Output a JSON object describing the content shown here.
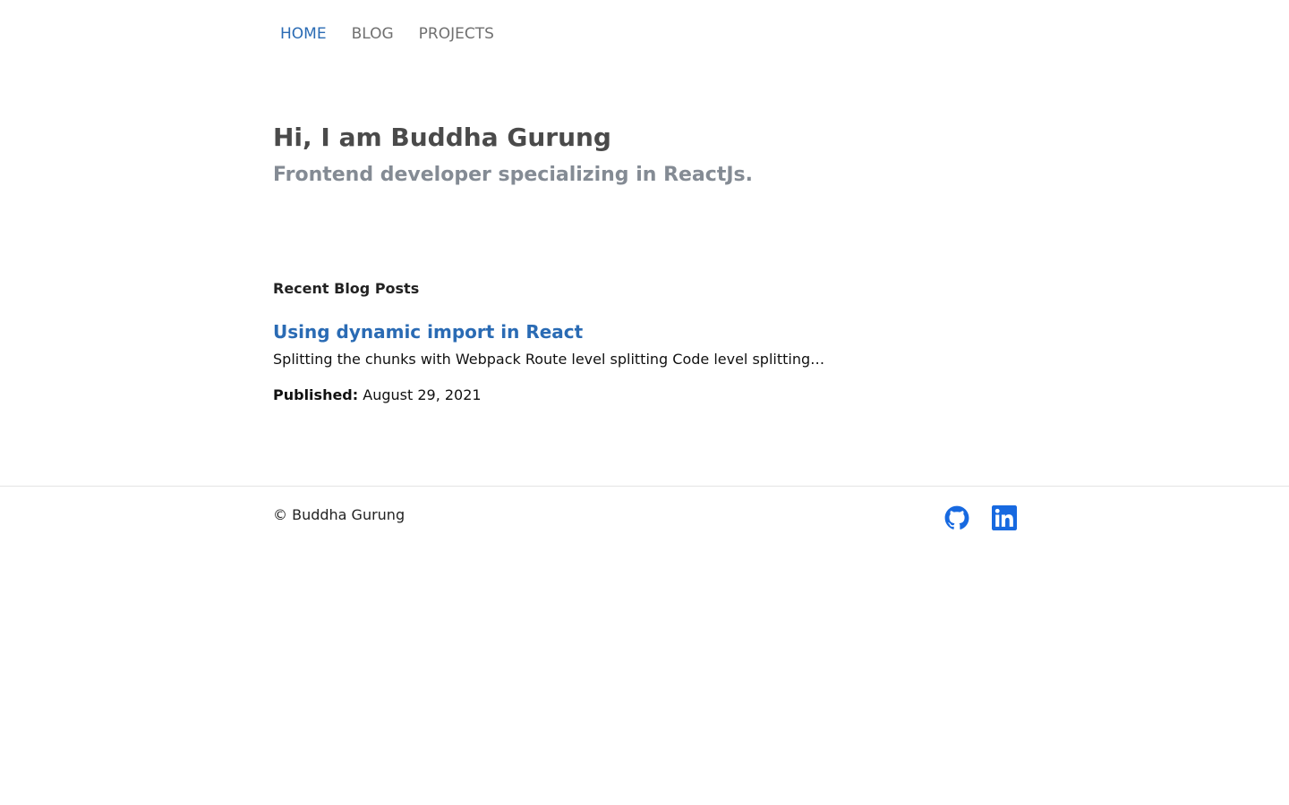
{
  "nav": {
    "items": [
      {
        "label": "HOME",
        "active": true
      },
      {
        "label": "BLOG",
        "active": false
      },
      {
        "label": "PROJECTS",
        "active": false
      }
    ]
  },
  "hero": {
    "title": "Hi, I am Buddha Gurung",
    "subtitle": "Frontend developer specializing in ReactJs."
  },
  "blog": {
    "heading": "Recent Blog Posts",
    "posts": [
      {
        "title": "Using dynamic import in React",
        "excerpt": "Splitting the chunks with Webpack Route level splitting Code level splitting…",
        "published_label": "Published:",
        "published_date": "August 29, 2021"
      }
    ]
  },
  "footer": {
    "copyright": "© Buddha Gurung",
    "social": [
      {
        "icon": "github-icon"
      },
      {
        "icon": "linkedin-icon"
      }
    ]
  },
  "colors": {
    "accent": "#2a6bb4",
    "nav_inactive": "#707070",
    "social_icon": "#1769e0"
  }
}
